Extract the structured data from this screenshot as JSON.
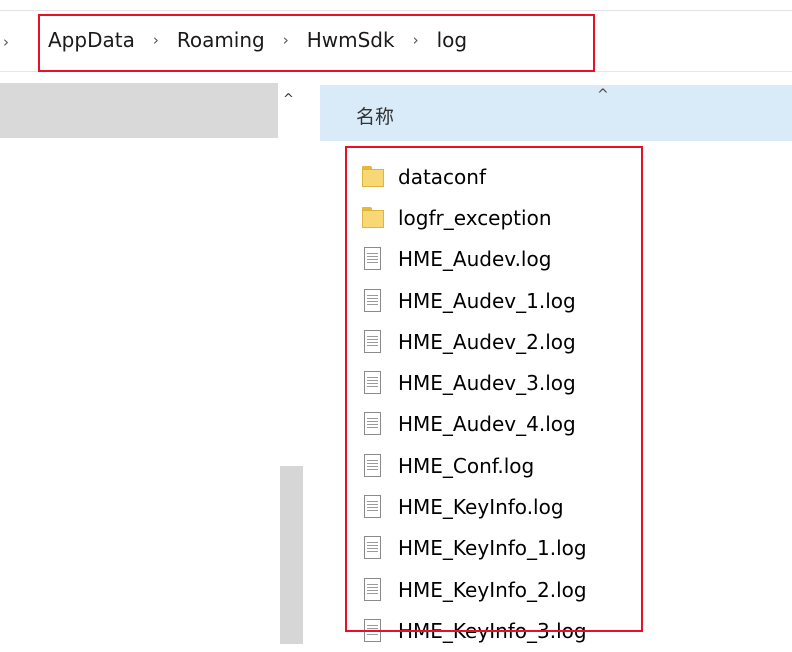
{
  "address_bar": {
    "lead_separator": "›",
    "separator": "›",
    "crumbs": [
      "AppData",
      "Roaming",
      "HwmSdk",
      "log"
    ]
  },
  "nav_pane": {
    "scroll_up_glyph": "^"
  },
  "column_header": {
    "name_label": "名称",
    "sort_glyph": "^"
  },
  "files": [
    {
      "name": "dataconf",
      "type": "folder"
    },
    {
      "name": "logfr_exception",
      "type": "folder"
    },
    {
      "name": "HME_Audev.log",
      "type": "file"
    },
    {
      "name": "HME_Audev_1.log",
      "type": "file"
    },
    {
      "name": "HME_Audev_2.log",
      "type": "file"
    },
    {
      "name": "HME_Audev_3.log",
      "type": "file"
    },
    {
      "name": "HME_Audev_4.log",
      "type": "file"
    },
    {
      "name": "HME_Conf.log",
      "type": "file"
    },
    {
      "name": "HME_KeyInfo.log",
      "type": "file"
    },
    {
      "name": "HME_KeyInfo_1.log",
      "type": "file"
    },
    {
      "name": "HME_KeyInfo_2.log",
      "type": "file"
    },
    {
      "name": "HME_KeyInfo_3.log",
      "type": "file"
    }
  ],
  "colors": {
    "highlight": "#e81123",
    "header_bg": "#d9ebf9",
    "nav_selected": "#d9d9d9"
  }
}
